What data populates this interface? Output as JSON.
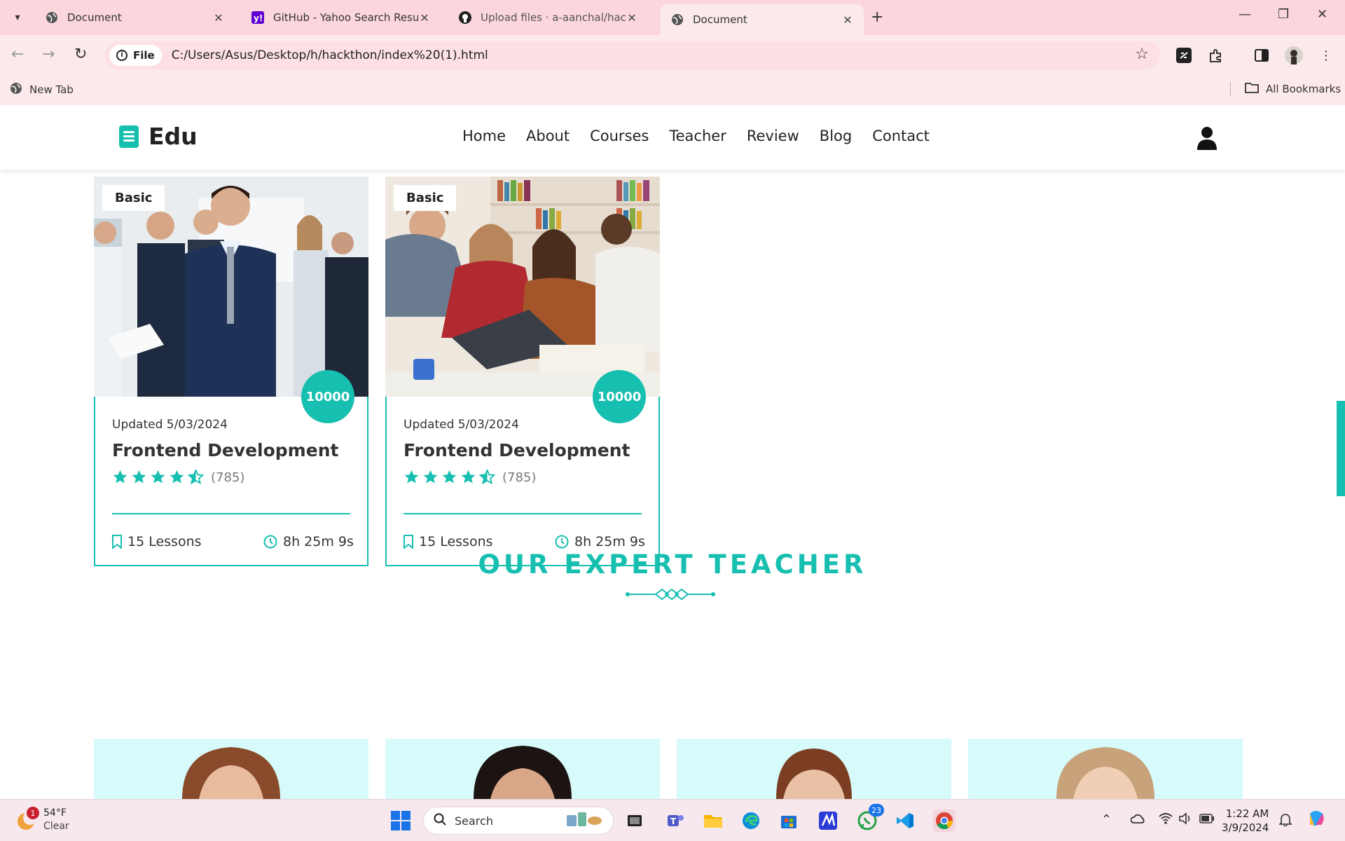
{
  "browser": {
    "tabs": [
      {
        "title": "Document",
        "favicon": "globe-icon",
        "active": false
      },
      {
        "title": "GitHub - Yahoo Search Results",
        "favicon": "yahoo-icon",
        "active": false
      },
      {
        "title": "Upload files · a-aanchal/hackath",
        "favicon": "github-icon",
        "active": false
      },
      {
        "title": "Document",
        "favicon": "globe-icon",
        "active": true
      }
    ],
    "address_chip": "File",
    "url": "C:/Users/Asus/Desktop/h/hackthon/index%20(1).html",
    "bookmarks": {
      "new_tab": "New Tab",
      "all": "All Bookmarks"
    }
  },
  "site": {
    "logo": "Edu",
    "nav": [
      "Home",
      "About",
      "Courses",
      "Teacher",
      "Review",
      "Blog",
      "Contact"
    ],
    "accent_color": "#17bfb0"
  },
  "courses": [
    {
      "badge": "Basic",
      "price": "10000",
      "updated": "Updated 5/03/2024",
      "title": "Frontend Development",
      "rating": 4.5,
      "reviews": "(785)",
      "lessons": "15 Lessons",
      "duration": "8h 25m 9s",
      "image": "business-team-photo"
    },
    {
      "badge": "Basic",
      "price": "10000",
      "updated": "Updated 5/03/2024",
      "title": "Frontend Development",
      "rating": 4.5,
      "reviews": "(785)",
      "lessons": "15 Lessons",
      "duration": "8h 25m 9s",
      "image": "students-laptop-photo"
    }
  ],
  "section": {
    "title": "OUR EXPERT TEACHER"
  },
  "taskbar": {
    "weather_temp": "54°F",
    "weather_text": "Clear",
    "weather_badge": "1",
    "search": "Search",
    "whatsapp_badge": "23",
    "time": "1:22 AM",
    "date": "3/9/2024"
  }
}
